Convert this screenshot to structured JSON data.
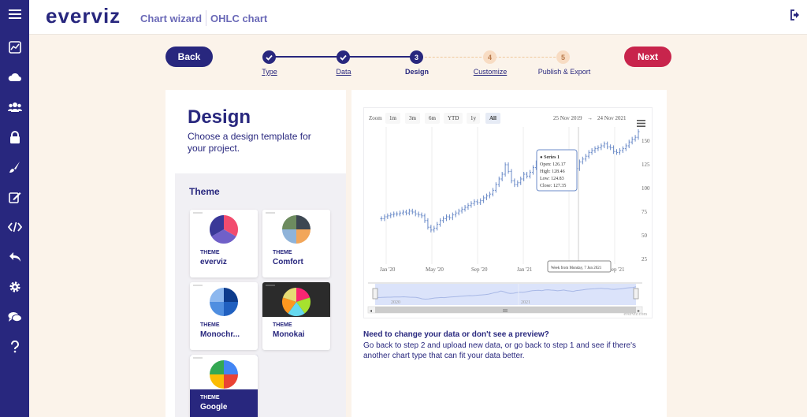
{
  "app": {
    "logo": "everviz",
    "breadcrumb": [
      "Chart wizard",
      "OHLC chart"
    ]
  },
  "sidebar": {
    "icons": [
      "menu-icon",
      "chart-icon",
      "cloud-icon",
      "users-icon",
      "lock-icon",
      "brush-icon",
      "edit-icon",
      "code-icon",
      "undo-icon",
      "settings-icon",
      "chat-icon",
      "help-icon"
    ]
  },
  "nav": {
    "back_label": "Back",
    "next_label": "Next"
  },
  "steps": [
    {
      "num": "1",
      "label": "Type",
      "state": "done"
    },
    {
      "num": "2",
      "label": "Data",
      "state": "done"
    },
    {
      "num": "3",
      "label": "Design",
      "state": "current"
    },
    {
      "num": "4",
      "label": "Customize",
      "state": "upcoming"
    },
    {
      "num": "5",
      "label": "Publish & Export",
      "state": "upcoming"
    }
  ],
  "design": {
    "title": "Design",
    "description": "Choose a design template for your project.",
    "theme_heading": "Theme",
    "themes": [
      {
        "label": "THEME",
        "name": "everviz",
        "colors": [
          "#f24c6e",
          "#7060c8",
          "#3a3898"
        ],
        "dark": false
      },
      {
        "label": "THEME",
        "name": "Comfort",
        "colors": [
          "#3d4752",
          "#f2a65a",
          "#8fb3d9",
          "#6d8b5f"
        ],
        "dark": false
      },
      {
        "label": "THEME",
        "name": "Monochr...",
        "colors": [
          "#0d3b8c",
          "#2060c0",
          "#4f8ee0",
          "#8db8ef"
        ],
        "dark": false
      },
      {
        "label": "THEME",
        "name": "Monokai",
        "colors": [
          "#f92672",
          "#a6e22e",
          "#66d9ef",
          "#fd971f",
          "#e6db74"
        ],
        "dark": true
      },
      {
        "label": "THEME",
        "name": "Google",
        "colors": [
          "#4285f4",
          "#ea4335",
          "#fbbc05",
          "#34a853"
        ],
        "dark": false,
        "selected": true
      }
    ]
  },
  "chart": {
    "zoom_label": "Zoom",
    "zoom_buttons": [
      "1m",
      "3m",
      "6m",
      "YTD",
      "1y",
      "All"
    ],
    "active_zoom": "All",
    "range_from": "25 Nov 2019",
    "range_arrow": "→",
    "range_to": "24 Nov 2021",
    "credits": "everviz.com",
    "tooltip_date": "Week from Monday, 7 Jun 2021"
  },
  "chart_data": {
    "type": "ohlc",
    "title": "",
    "x_labels": [
      "Jan '20",
      "May '20",
      "Sep '20",
      "Jan '21",
      "May '21",
      "Sep '21"
    ],
    "y_ticks": [
      25,
      50,
      75,
      100,
      125,
      150
    ],
    "ylim": [
      20,
      165
    ],
    "navigator_labels": [
      "2020",
      "2021"
    ],
    "tooltip": {
      "series": "Series 1",
      "open": "Open: 126.17",
      "high": "High: 128.46",
      "low": "Low: 124.83",
      "close": "Close: 127.35"
    },
    "series": [
      {
        "close": [
          68,
          70,
          71,
          72,
          73,
          73,
          74,
          75,
          74,
          76,
          75,
          73,
          72,
          71,
          66,
          59,
          56,
          58,
          62,
          66,
          68,
          70,
          69,
          72,
          74,
          76,
          78,
          80,
          82,
          84,
          86,
          85,
          87,
          90,
          92,
          94,
          98,
          104,
          110,
          115,
          125,
          118,
          108,
          104,
          106,
          110,
          115,
          113,
          117,
          122,
          127,
          129,
          130,
          127,
          133,
          135,
          132,
          130,
          126,
          129,
          133,
          127,
          125,
          121,
          128,
          131,
          134,
          138,
          140,
          142,
          143,
          145,
          147,
          144,
          143,
          139,
          138,
          140,
          142,
          145,
          149,
          152,
          154,
          160
        ]
      }
    ]
  }
}
